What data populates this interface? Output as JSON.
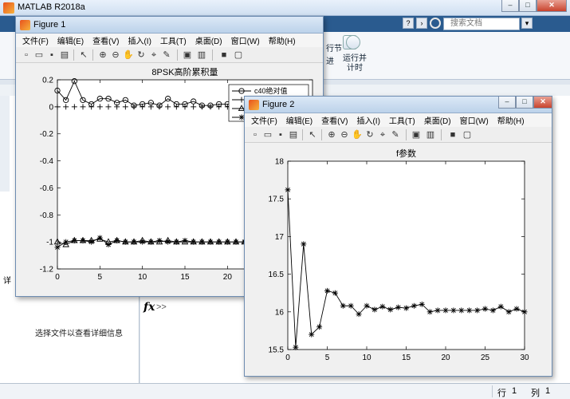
{
  "app": {
    "title": "MATLAB R2018a"
  },
  "search": {
    "placeholder": "搜索文档"
  },
  "ribbon": {
    "item1": "行节",
    "item2": "运行并\n计时",
    "item3": "进"
  },
  "panels": {
    "left_tab": "详",
    "detail_text": "选择文件以查看详细信息",
    "fx": "fx",
    "chevron": ">>"
  },
  "status": {
    "row_label": "行",
    "row": "1",
    "col_label": "列",
    "col": "1"
  },
  "figure1": {
    "title": "Figure 1",
    "menus": [
      "文件(F)",
      "编辑(E)",
      "查看(V)",
      "插入(I)",
      "工具(T)",
      "桌面(D)",
      "窗口(W)",
      "帮助(H)"
    ],
    "chart_data": {
      "type": "line",
      "title": "8PSK高阶累积量",
      "xlabel": "",
      "ylabel": "",
      "xlim": [
        0,
        30
      ],
      "ylim": [
        -1.2,
        0.2
      ],
      "x_ticks": [
        0,
        5,
        10,
        15,
        20
      ],
      "y_ticks": [
        0.2,
        0,
        -0.2,
        -0.4,
        -0.6,
        -0.8,
        -1,
        -1.2
      ],
      "legend": {
        "placement": "top-right",
        "entries": [
          "c40绝对值"
        ]
      },
      "series": [
        {
          "name": "c40绝对值",
          "marker": "circle",
          "x": [
            0,
            1,
            2,
            3,
            4,
            5,
            6,
            7,
            8,
            9,
            10,
            11,
            12,
            13,
            14,
            15,
            16,
            17,
            18,
            19,
            20,
            21,
            22,
            23,
            24,
            25,
            26,
            27,
            28,
            29,
            30
          ],
          "y": [
            0.12,
            0.05,
            0.19,
            0.05,
            0.02,
            0.06,
            0.06,
            0.03,
            0.05,
            0.01,
            0.02,
            0.03,
            0.01,
            0.06,
            0.02,
            0.02,
            0.04,
            0.01,
            0.01,
            0.02,
            0.02,
            0.02,
            0.02,
            0.02,
            0.02,
            0.02,
            0.02,
            0.02,
            0.02,
            0.02,
            0.02
          ]
        },
        {
          "name": "",
          "marker": "plus",
          "x": [
            0,
            1,
            2,
            3,
            4,
            5,
            6,
            7,
            8,
            9,
            10,
            11,
            12,
            13,
            14,
            15,
            16,
            17,
            18,
            19,
            20,
            21,
            22,
            23,
            24,
            25,
            26,
            27,
            28,
            29,
            30
          ],
          "y": [
            0,
            0,
            0,
            0,
            0,
            0,
            0,
            0,
            0,
            0,
            0,
            0,
            0,
            0,
            0,
            0,
            0,
            0,
            0,
            0,
            0,
            0,
            0,
            0,
            0,
            0,
            0,
            0,
            0,
            0,
            0
          ]
        },
        {
          "name": "",
          "marker": "triangle",
          "x": [
            0,
            1,
            2,
            3,
            4,
            5,
            6,
            7,
            8,
            9,
            10,
            11,
            12,
            13,
            14,
            15,
            16,
            17,
            18,
            19,
            20,
            21,
            22,
            23,
            24,
            25,
            26,
            27,
            28,
            29,
            30
          ],
          "y": [
            -1.0,
            -1.02,
            -0.99,
            -0.99,
            -0.99,
            -0.98,
            -1.0,
            -0.99,
            -1.0,
            -1.0,
            -0.99,
            -1.0,
            -1.0,
            -0.99,
            -1.0,
            -1.0,
            -1.0,
            -1.0,
            -1.0,
            -1.0,
            -1.0,
            -1.0,
            -1.0,
            -1.0,
            -1.0,
            -1.0,
            -1.0,
            -1.0,
            -1.0,
            -1.0,
            -1.0
          ]
        },
        {
          "name": "",
          "marker": "star",
          "x": [
            0,
            1,
            2,
            3,
            4,
            5,
            6,
            7,
            8,
            9,
            10,
            11,
            12,
            13,
            14,
            15,
            16,
            17,
            18,
            19,
            20,
            21,
            22,
            23,
            24,
            25,
            26,
            27,
            28,
            29,
            30
          ],
          "y": [
            -1.04,
            -1.0,
            -0.99,
            -0.99,
            -1.0,
            -0.97,
            -1.02,
            -0.99,
            -1.0,
            -1.0,
            -1.0,
            -1.0,
            -0.99,
            -1.0,
            -1.0,
            -0.99,
            -1.0,
            -1.0,
            -1.0,
            -1.0,
            -1.0,
            -1.0,
            -1.0,
            -1.0,
            -1.0,
            -1.0,
            -1.0,
            -1.0,
            -1.0,
            -1.0,
            -1.0
          ]
        }
      ]
    }
  },
  "figure2": {
    "title": "Figure 2",
    "menus": [
      "文件(F)",
      "编辑(E)",
      "查看(V)",
      "插入(I)",
      "工具(T)",
      "桌面(D)",
      "窗口(W)",
      "帮助(H)"
    ],
    "chart_data": {
      "type": "line",
      "title": "f参数",
      "xlabel": "",
      "ylabel": "",
      "xlim": [
        0,
        30
      ],
      "ylim": [
        15.5,
        18
      ],
      "x_ticks": [
        0,
        5,
        10,
        15,
        20,
        25,
        30
      ],
      "y_ticks": [
        18,
        17.5,
        17,
        16.5,
        16,
        15.5
      ],
      "series": [
        {
          "name": "",
          "marker": "star",
          "x": [
            0,
            1,
            2,
            3,
            4,
            5,
            6,
            7,
            8,
            9,
            10,
            11,
            12,
            13,
            14,
            15,
            16,
            17,
            18,
            19,
            20,
            21,
            22,
            23,
            24,
            25,
            26,
            27,
            28,
            29,
            30
          ],
          "y": [
            17.62,
            15.53,
            16.9,
            15.7,
            15.8,
            16.28,
            16.25,
            16.08,
            16.08,
            15.97,
            16.08,
            16.03,
            16.07,
            16.03,
            16.06,
            16.05,
            16.08,
            16.1,
            16.0,
            16.02,
            16.02,
            16.02,
            16.02,
            16.02,
            16.02,
            16.04,
            16.02,
            16.07,
            16.0,
            16.04,
            16.0
          ]
        }
      ]
    }
  }
}
